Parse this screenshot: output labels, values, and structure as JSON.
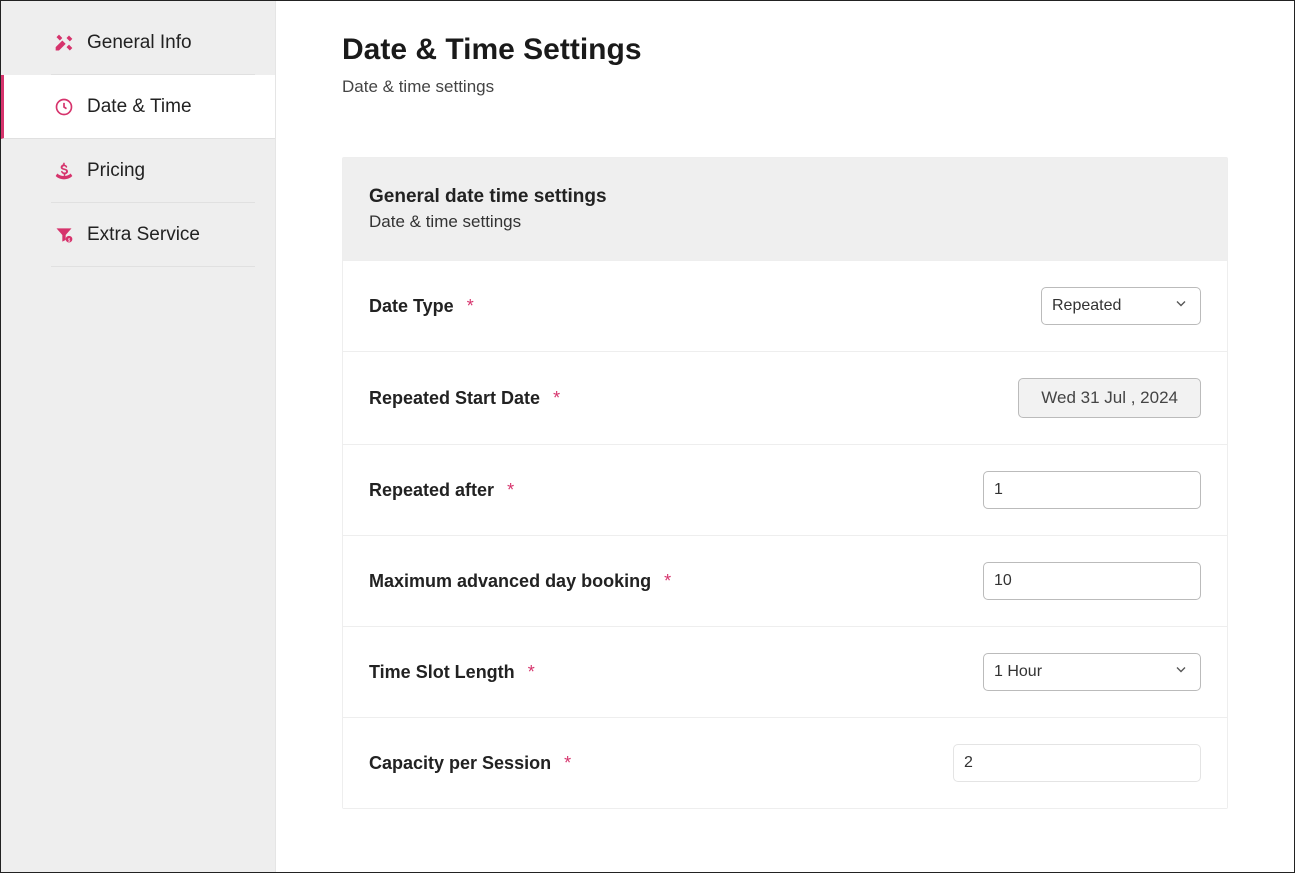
{
  "sidebar": {
    "items": [
      {
        "label": "General Info"
      },
      {
        "label": "Date & Time"
      },
      {
        "label": "Pricing"
      },
      {
        "label": "Extra Service"
      }
    ]
  },
  "page": {
    "title": "Date & Time Settings",
    "subtitle": "Date & time settings"
  },
  "card": {
    "title": "General date time settings",
    "subtitle": "Date & time settings"
  },
  "form": {
    "date_type": {
      "label": "Date Type",
      "value": "Repeated"
    },
    "repeated_start_date": {
      "label": "Repeated Start Date",
      "value": "Wed 31 Jul , 2024"
    },
    "repeated_after": {
      "label": "Repeated after",
      "value": "1"
    },
    "max_advanced": {
      "label": "Maximum advanced day booking",
      "value": "10"
    },
    "time_slot_length": {
      "label": "Time Slot Length",
      "value": "1 Hour"
    },
    "capacity_per_session": {
      "label": "Capacity per Session",
      "value": "2"
    }
  },
  "required_marker": "*"
}
